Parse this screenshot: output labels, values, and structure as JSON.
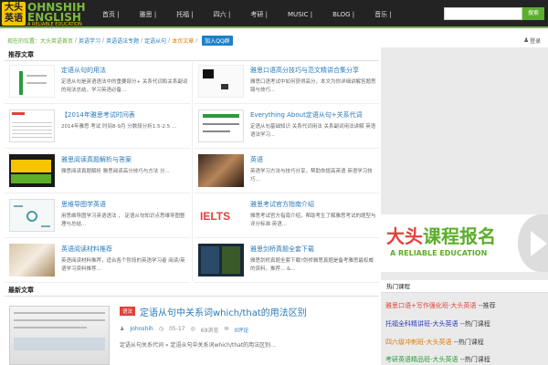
{
  "logo": {
    "badge": "大头英语",
    "line1": "OHNSHIH",
    "line2": "ENGLISH",
    "line3": "A RELIABLE EDUCATION"
  },
  "nav": {
    "items": [
      "首页 |",
      "雅思 |",
      "托福 |",
      "四六 |",
      "考研 |",
      "MUSIC |",
      "BLOG |",
      "音乐 |"
    ],
    "search_button": "搜索"
  },
  "breadcrumb": {
    "home": "现在的位置：大头英语首页",
    "links": [
      "英语学习",
      "英语语法专题",
      "定语从句"
    ],
    "current": "本页文章",
    "qq_button": "加入QQ群"
  },
  "user": {
    "label": "登录"
  },
  "featured": {
    "heading": "推荐文章",
    "cards": [
      {
        "title": "定语从句的用法",
        "desc": "定语从句是英语语法中的重要部分+ 关系代词和关系副词的用法总结，学习英语必备..."
      },
      {
        "title": "雅思口语高分技巧与范文精讲合集分享",
        "desc": "雅思口语考试中如何获得高分，本文为你详细讲解答题思路与技巧..."
      },
      {
        "title": "【2014年雅思考试时间表",
        "desc": "2014年雅思 考试 时间8-9月 分数段分析1.5-2.5 ..."
      },
      {
        "title": "Everything About定语从句+关系代词",
        "desc": "定语从句基础知识   关系代词用法 关系副词用法讲解 英语语法学习..."
      },
      {
        "title": "雅思阅读真题解析与答案",
        "desc": "   雅思阅读真题解析       雅思阅读高分技巧与方法       分..."
      },
      {
        "title": "英语",
        "desc": "英语学习方法与技巧分享，帮助你提高英语    英语学习技巧..."
      },
      {
        "title": "思维导图学英语",
        "desc": "   用思维导图学习英语语法 ，  定语从句知识点思维导图整理与总结..."
      },
      {
        "title": "雅思考试官方指南介绍",
        "desc": "雅思考试官方指南介绍，帮助考生了解雅思考试的题型与评分标准·英语..."
      },
      {
        "title": "英语阅读材料推荐",
        "desc": "英语阅读材料推荐，适合各个阶段的英语学习者 阅读/英语学习资料推荐..."
      },
      {
        "title": "雅思剑桥真题全套下载",
        "desc": "雅思剑桥真题全套下载?剑桥雅思真题是备考雅思最权威的资料，推荐...   &..."
      }
    ]
  },
  "articles": {
    "heading": "最新文章",
    "items": [
      {
        "tag": "语法",
        "title": "定语从句中关系词which/that的用法区别",
        "author": "Johnshih",
        "date": "05-17",
        "views": "69浏览",
        "comments": "0评论",
        "desc": "定语从句关系代词 » 定语从句中关系词which/that的用法区别..."
      }
    ]
  },
  "banner": {
    "cn_left": "大头",
    "cn_right": "课程报名",
    "en": "A RELIABLE EDUCATION"
  },
  "sidebar": {
    "heading": "热门课程",
    "items": [
      {
        "label": "雅思口语+写作强化班-大头英语",
        "suffix": " --推荐",
        "color": "#e2413b"
      },
      {
        "label": "托福全科精讲班-大头英语",
        "suffix": " --热门课程",
        "color": "#2a3ab8"
      },
      {
        "label": "四六级冲刺班-大头英语",
        "suffix": " --热门课程",
        "color": "#e07a00"
      },
      {
        "label": "考研英语精品班-大头英语",
        "suffix": " --热门课程",
        "color": "#2a9b3a"
      }
    ]
  }
}
